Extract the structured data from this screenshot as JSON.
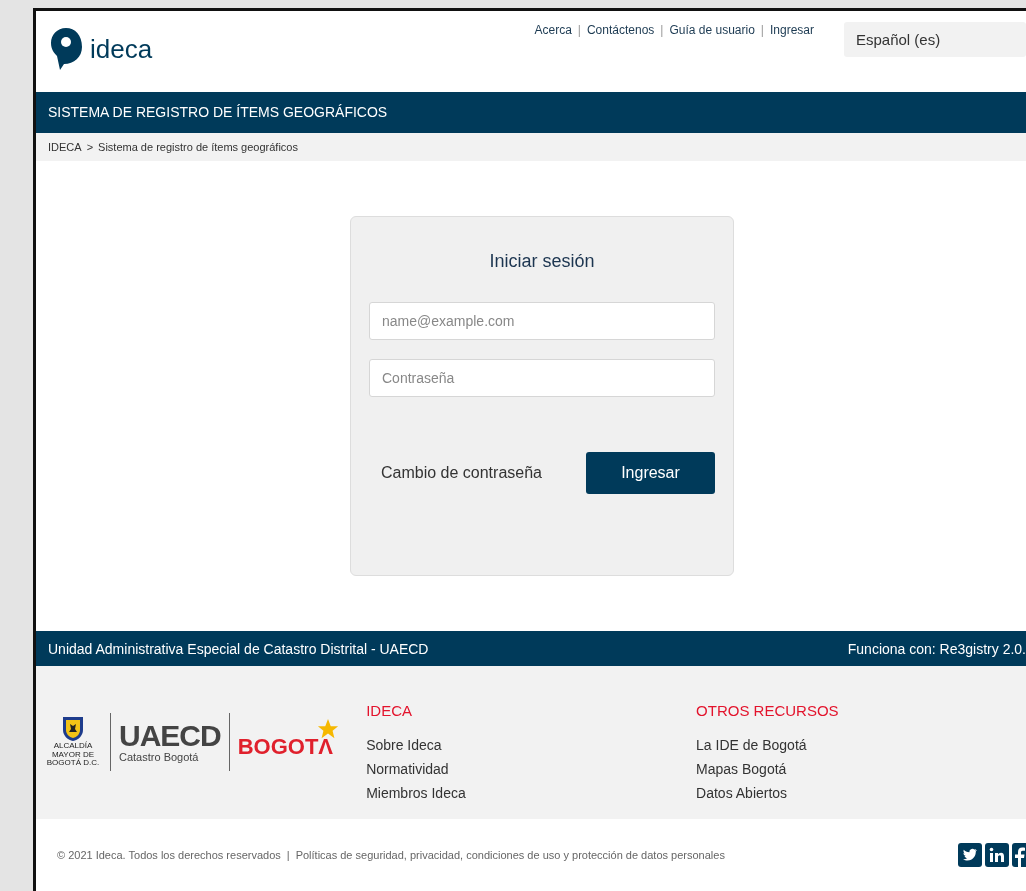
{
  "header": {
    "logo_text": "ideca",
    "nav_links": [
      "Acerca",
      "Contáctenos",
      "Guía de usuario",
      "Ingresar"
    ],
    "nav_separator": "|",
    "language": "Español (es)"
  },
  "title_bar": "SISTEMA DE REGISTRO DE ÍTEMS GEOGRÁFICOS",
  "breadcrumb": {
    "items": [
      "IDECA",
      "Sistema de registro de ítems geográficos"
    ],
    "separator": ">"
  },
  "login": {
    "title": "Iniciar sesión",
    "username": {
      "placeholder": "name@example.com"
    },
    "password": {
      "placeholder": "Contraseña"
    },
    "forgot_link": "Cambio de contraseña",
    "submit": "Ingresar"
  },
  "footer_bar": {
    "left": "Unidad Administrativa Especial de Catastro Distrital - UAECD",
    "right": "Funciona con: Re3gistry 2.0."
  },
  "footer_logos": {
    "crest_caption": "ALCALDÍA MAYOR DE BOGOTÁ D.C.",
    "uaecd": "UAECD",
    "uaecd_sub": "Catastro Bogotá",
    "city": "BOGOTΛ"
  },
  "footer_columns": [
    {
      "heading": "IDECA",
      "links": [
        "Sobre Ideca",
        "Normatividad",
        "Miembros Ideca"
      ]
    },
    {
      "heading": "OTROS RECURSOS",
      "links": [
        "La IDE de Bogotá",
        "Mapas Bogotá",
        "Datos Abiertos"
      ]
    }
  ],
  "copyright": {
    "text": "© 2021 Ideca. Todos los derechos reservados",
    "separator": "|",
    "policy_link": "Políticas de seguridad, privacidad, condiciones de uso y protección de datos personales"
  }
}
